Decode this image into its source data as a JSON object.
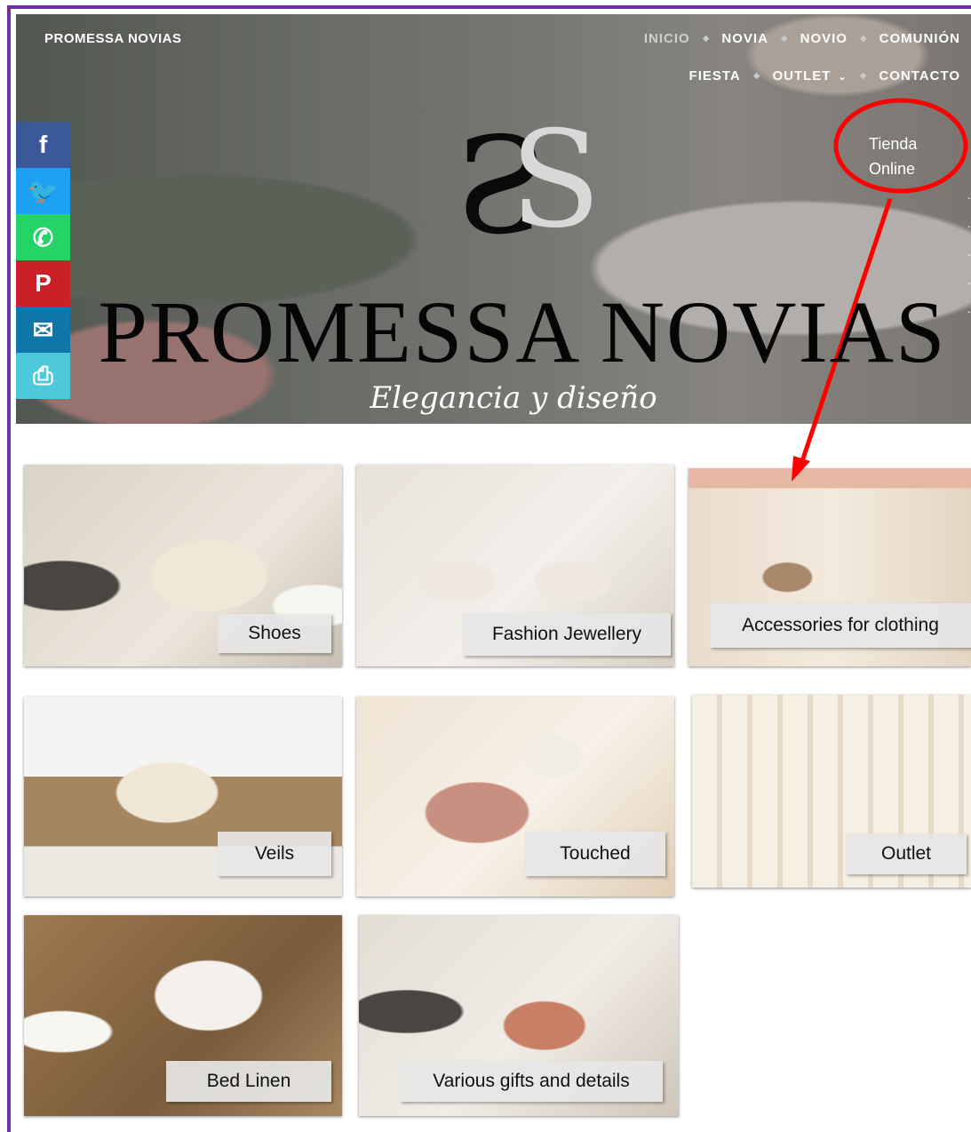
{
  "header": {
    "brand": "PROMESSA NOVIAS",
    "nav_row1": [
      "INICIO",
      "NOVIA",
      "NOVIO",
      "COMUNIÓN"
    ],
    "nav_row2": [
      "FIESTA",
      "OUTLET",
      "CONTACTO"
    ],
    "active_nav": "INICIO"
  },
  "hero": {
    "logo_title": "PROMESSA NOVIAS",
    "tagline": "Elegancia y diseño",
    "annotation_line1": "Tienda",
    "annotation_line2": "Online"
  },
  "social": [
    {
      "icon": "facebook-icon",
      "glyph": "f",
      "color": "#3b5998"
    },
    {
      "icon": "twitter-icon",
      "glyph": "🐦",
      "color": "#1da1f2"
    },
    {
      "icon": "whatsapp-icon",
      "glyph": "✆",
      "color": "#25d366"
    },
    {
      "icon": "pinterest-icon",
      "glyph": "P",
      "color": "#cb2027"
    },
    {
      "icon": "email-icon",
      "glyph": "✉",
      "color": "#0e76a8"
    },
    {
      "icon": "print-icon",
      "glyph": "⎙",
      "color": "#4fc9da"
    }
  ],
  "categories": [
    {
      "label": "Shoes"
    },
    {
      "label": "Fashion Jewellery"
    },
    {
      "label": "Accessories for clothing"
    },
    {
      "label": "Veils"
    },
    {
      "label": "Touched"
    },
    {
      "label": "Outlet"
    },
    {
      "label": "Bed Linen"
    },
    {
      "label": "Various gifts and details"
    }
  ],
  "colors": {
    "frame": "#7030a0",
    "annotation": "#ff0000"
  }
}
